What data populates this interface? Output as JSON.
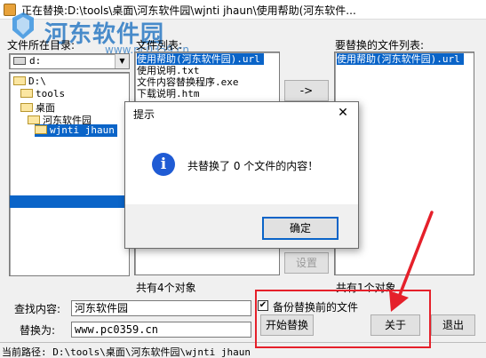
{
  "window": {
    "title": "正在替换:D:\\tools\\桌面\\河东软件园\\wjnti jhaun\\使用帮助(河东软件..."
  },
  "watermark": {
    "brand": "河东软件园",
    "url": "www.pc0359.cn"
  },
  "left_panel": {
    "dir_label": "文件所在目录:",
    "drive": "d:",
    "tree": [
      "D:\\",
      "tools",
      "桌面",
      "河东软件园",
      "wjnti jhaun"
    ],
    "selected_index": 4
  },
  "file_list": {
    "label": "文件列表:",
    "items": [
      "使用帮助(河东软件园).url",
      "使用说明.txt",
      "文件内容替换程序.exe",
      "下载说明.htm"
    ],
    "selected_index": 0,
    "count_label": "共有4个对象"
  },
  "buttons": {
    "add": "->",
    "settings": "设置",
    "start": "开始替换",
    "about": "关于",
    "exit": "退出"
  },
  "replace_list": {
    "label": "要替换的文件列表:",
    "items": [
      "使用帮助(河东软件园).url"
    ],
    "count_label": "共有1个对象"
  },
  "form": {
    "find_label": "查找内容:",
    "find_value": "河东软件园",
    "replace_label": "替换为:",
    "replace_value": "www.pc0359.cn",
    "backup_label": "备份替换前的文件",
    "backup_checked": true,
    "check_mark": "✔"
  },
  "status": {
    "text": "当前路径: D:\\tools\\桌面\\河东软件园\\wjnti jhaun"
  },
  "dialog": {
    "title": "提示",
    "close_glyph": "✕",
    "info_glyph": "i",
    "message": "共替换了  0 个文件的内容！",
    "ok": "确定"
  },
  "colors": {
    "selection": "#0a64c8",
    "annotation": "#e5202a",
    "watermark": "#1a6fc0"
  }
}
